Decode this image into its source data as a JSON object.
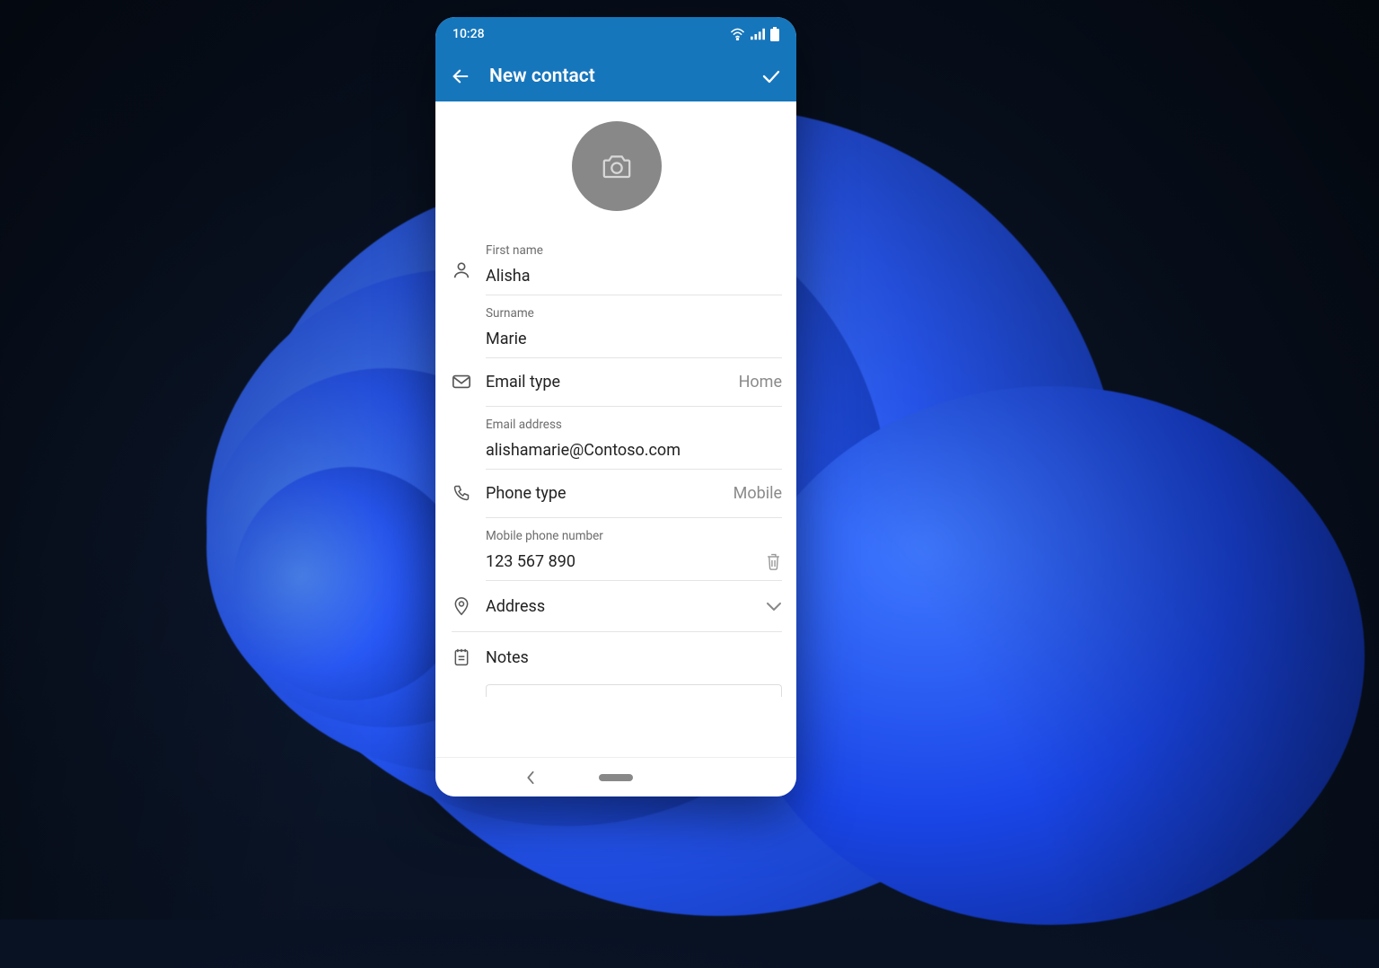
{
  "status": {
    "time": "10:28"
  },
  "header": {
    "title": "New contact"
  },
  "fields": {
    "first_name_label": "First name",
    "first_name_value": "Alisha",
    "surname_label": "Surname",
    "surname_value": "Marie",
    "email_type_label": "Email type",
    "email_type_value": "Home",
    "email_address_label": "Email address",
    "email_address_value": "alishamarie@Contoso.com",
    "phone_type_label": "Phone type",
    "phone_type_value": "Mobile",
    "mobile_label": "Mobile phone number",
    "mobile_value": "123 567 890",
    "address_label": "Address",
    "notes_label": "Notes"
  }
}
